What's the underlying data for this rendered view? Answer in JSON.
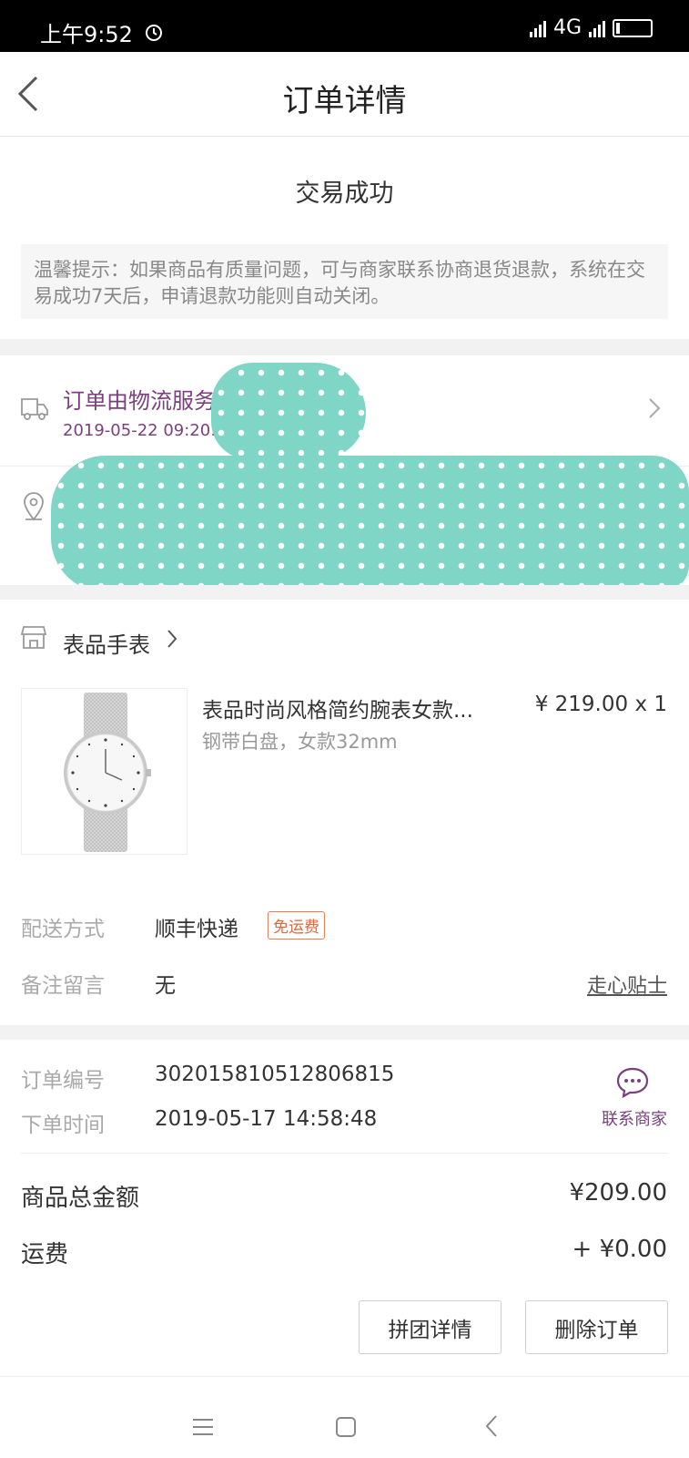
{
  "status_bar": {
    "time": "上午9:52",
    "network": "4G"
  },
  "nav": {
    "title": "订单详情"
  },
  "order_status": "交易成功",
  "notice": "温馨提示：如果商品有质量问题，可与商家联系协商退货退款，系统在交易成功7天后，申请退款功能则自动关闭。",
  "logistics": {
    "text": "订单由物流服务",
    "time": "2019-05-22 09:20:43"
  },
  "shop": {
    "name": "表品手表"
  },
  "product": {
    "name": "表品时尚风格简约腕表女款...",
    "spec": "钢带白盘，女款32mm",
    "price": "¥ 219.00",
    "quantity": "x 1"
  },
  "delivery": {
    "label": "配送方式",
    "value": "顺丰快递",
    "badge": "免运费"
  },
  "remark": {
    "label": "备注留言",
    "value": "无",
    "link": "走心贴士"
  },
  "order_info": {
    "number_label": "订单编号",
    "number": "302015810512806815",
    "time_label": "下单时间",
    "time": "2019-05-17 14:58:48",
    "contact_label": "联系商家"
  },
  "totals": {
    "goods_label": "商品总金额",
    "goods_value": "¥209.00",
    "shipping_label": "运费",
    "shipping_value": "+ ¥0.00"
  },
  "buttons": {
    "group_detail": "拼团详情",
    "delete_order": "删除订单"
  },
  "colors": {
    "accent": "#7b3f7f",
    "badge": "#e0663b",
    "redaction": "#7fd6c7"
  }
}
